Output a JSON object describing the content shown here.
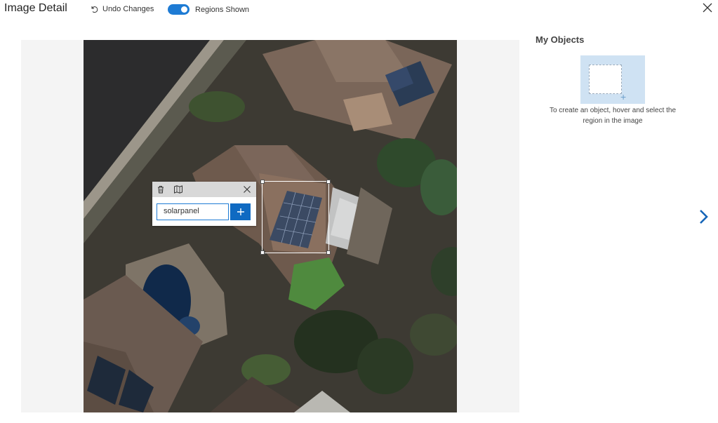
{
  "header": {
    "title": "Image Detail",
    "undo_label": "Undo Changes",
    "toggle_label": "Regions Shown",
    "toggle_on": true
  },
  "tag_popup": {
    "input_value": "solarpanel",
    "add_symbol": "+"
  },
  "sidebar": {
    "title": "My Objects",
    "hint": "To create an object, hover and select the region in the image"
  },
  "icons": [
    "undo-icon",
    "close-icon",
    "trash-icon",
    "map-icon",
    "popup-close-icon",
    "plus-icon",
    "chevron-right-icon"
  ],
  "colors": {
    "accent": "#1e7bd4",
    "add_button": "#0f6ac2",
    "placeholder_card": "#cfe2f3",
    "stage_bg": "#f4f4f4"
  }
}
